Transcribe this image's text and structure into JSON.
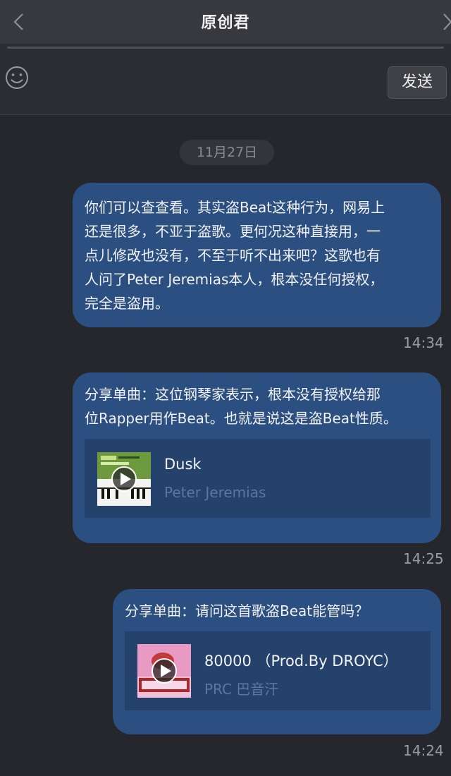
{
  "header": {
    "title": "原创君",
    "back_icon": "chevron-left-icon",
    "more_icon": "chevron-right-icon"
  },
  "input_bar": {
    "emoji_icon": "smiley-icon",
    "send_label": "发送"
  },
  "date_divider": "11月27日",
  "messages": [
    {
      "lines": [
        "你们可以查查看。其实盗Beat这种行为，网易上",
        "还是很多，不亚于盗歌。更何况这种直接用，一",
        "点儿修改也没有，不至于听不出来吧？这歌也有",
        "人问了Peter Jeremias本人，根本没任何授权，",
        "完全是盗用。"
      ],
      "time": "14:34"
    },
    {
      "lines": [
        "分享单曲：这位钢琴家表示，根本没有授权给那",
        "位Rapper用作Beat。也就是说这是盗Beat性质。"
      ],
      "song": {
        "title": "Dusk",
        "artist": "Peter Jeremias",
        "play_icon": "play-icon"
      },
      "time": "14:25"
    },
    {
      "lines": [
        "分享单曲：请问这首歌盗Beat能管吗？"
      ],
      "song": {
        "title": "80000 （Prod.By DROYC）",
        "artist": "PRC 巴音汗",
        "play_icon": "play-icon"
      },
      "time": "14:24"
    }
  ],
  "colors": {
    "background": "#26272c",
    "bubble": "#2b4f80",
    "card": "#24426b"
  }
}
